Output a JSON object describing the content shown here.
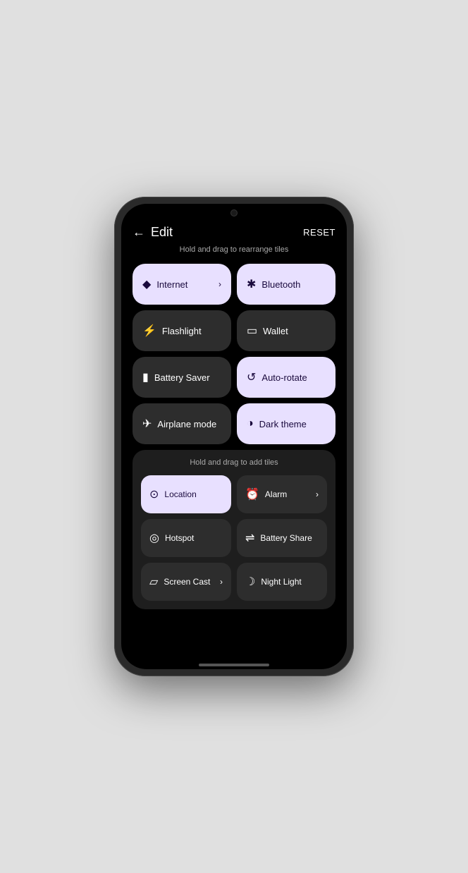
{
  "header": {
    "back_label": "←",
    "title": "Edit",
    "reset_label": "RESET"
  },
  "instructions": {
    "rearrange": "Hold and drag to rearrange tiles",
    "add": "Hold and drag to add tiles"
  },
  "active_tiles": [
    {
      "id": "internet",
      "label": "Internet",
      "icon": "wifi",
      "active": true,
      "chevron": true
    },
    {
      "id": "bluetooth",
      "label": "Bluetooth",
      "active": true,
      "icon": "bluetooth",
      "chevron": false
    },
    {
      "id": "flashlight",
      "label": "Flashlight",
      "active": false,
      "icon": "flashlight",
      "chevron": false
    },
    {
      "id": "wallet",
      "label": "Wallet",
      "active": false,
      "icon": "wallet",
      "chevron": false
    },
    {
      "id": "battery-saver",
      "label": "Battery Saver",
      "active": false,
      "icon": "battery",
      "chevron": false
    },
    {
      "id": "auto-rotate",
      "label": "Auto-rotate",
      "active": true,
      "icon": "rotate",
      "chevron": false
    },
    {
      "id": "airplane",
      "label": "Airplane mode",
      "active": false,
      "icon": "airplane",
      "chevron": false
    },
    {
      "id": "dark-theme",
      "label": "Dark theme",
      "active": true,
      "icon": "dark",
      "chevron": false
    }
  ],
  "add_tiles": [
    {
      "id": "location",
      "label": "Location",
      "active": true,
      "icon": "location",
      "chevron": false
    },
    {
      "id": "alarm",
      "label": "Alarm",
      "active": false,
      "icon": "alarm",
      "chevron": true
    },
    {
      "id": "hotspot",
      "label": "Hotspot",
      "active": false,
      "icon": "hotspot",
      "chevron": false
    },
    {
      "id": "battery-share",
      "label": "Battery Share",
      "active": false,
      "icon": "battery-share",
      "chevron": false
    },
    {
      "id": "screen-cast",
      "label": "Screen Cast",
      "active": false,
      "icon": "cast",
      "chevron": true
    },
    {
      "id": "night-light",
      "label": "Night Light",
      "active": false,
      "icon": "moon",
      "chevron": false
    }
  ],
  "icons": {
    "wifi": "▾",
    "bluetooth": "✦",
    "flashlight": "⚡",
    "wallet": "▬",
    "battery": "▮",
    "rotate": "↻",
    "airplane": "✈",
    "dark": "◑",
    "location": "◎",
    "alarm": "⏰",
    "hotspot": "⊙",
    "battery-share": "⟳",
    "cast": "▱",
    "moon": "☾"
  }
}
